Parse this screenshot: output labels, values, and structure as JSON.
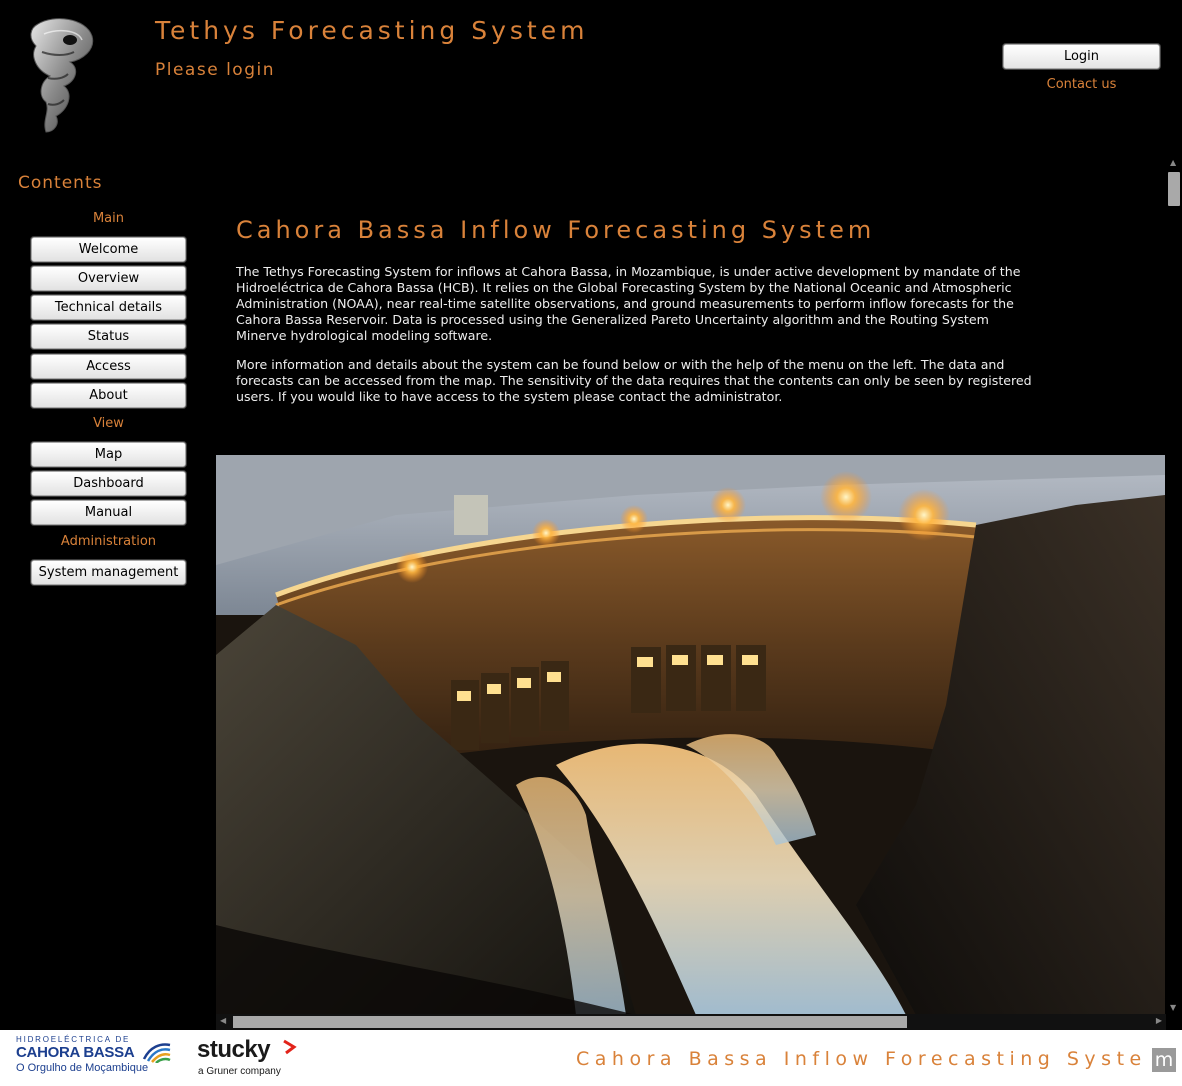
{
  "header": {
    "app_title": "Tethys Forecasting System",
    "login_status": "Please login",
    "login_label": "Login",
    "contact_label": "Contact us"
  },
  "sidebar": {
    "title": "Contents",
    "sections": [
      {
        "label": "Main",
        "items": [
          "Welcome",
          "Overview",
          "Technical details",
          "Status",
          "Access",
          "About"
        ]
      },
      {
        "label": "View",
        "items": [
          "Map",
          "Dashboard",
          "Manual"
        ]
      },
      {
        "label": "Administration",
        "items": [
          "System management"
        ]
      }
    ]
  },
  "main": {
    "title": "Cahora Bassa Inflow Forecasting System",
    "paragraph1": "The Tethys Forecasting System for inflows at Cahora Bassa, in Mozambique, is under active development by mandate of the Hidroeléctrica de Cahora Bassa (HCB). It relies on the Global Forecasting System by the National Oceanic and Atmospheric Administration (NOAA), near real-time satellite observations, and ground measurements to perform inflow forecasts for the Cahora Bassa Reservoir. Data is processed using the Generalized Pareto Uncertainty algorithm and the Routing System Minerve hydrological modeling software.",
    "paragraph2": "More information and details about the system can be found below or with the help of the menu on the left. The data and forecasts can be accessed from the map. The sensitivity of the data requires that the contents can only be seen by registered users. If you would like to have access to the system please contact the administrator.",
    "hero_image": "cahora-bassa-dam-night-photo"
  },
  "footer": {
    "hcb_small": "HIDROELÉCTRICA DE",
    "hcb_name": "CAHORA BASSA",
    "hcb_tagline": "O Orgulho de Moçambique",
    "stucky_name": "stucky",
    "stucky_sub": "a Gruner company",
    "title": "Cahora Bassa Inflow Forecasting Syste",
    "title_end": "m"
  },
  "colors": {
    "accent": "#d9823a",
    "background": "#000000",
    "hcb_blue": "#1c3f8f",
    "stucky_red": "#e2231a"
  }
}
